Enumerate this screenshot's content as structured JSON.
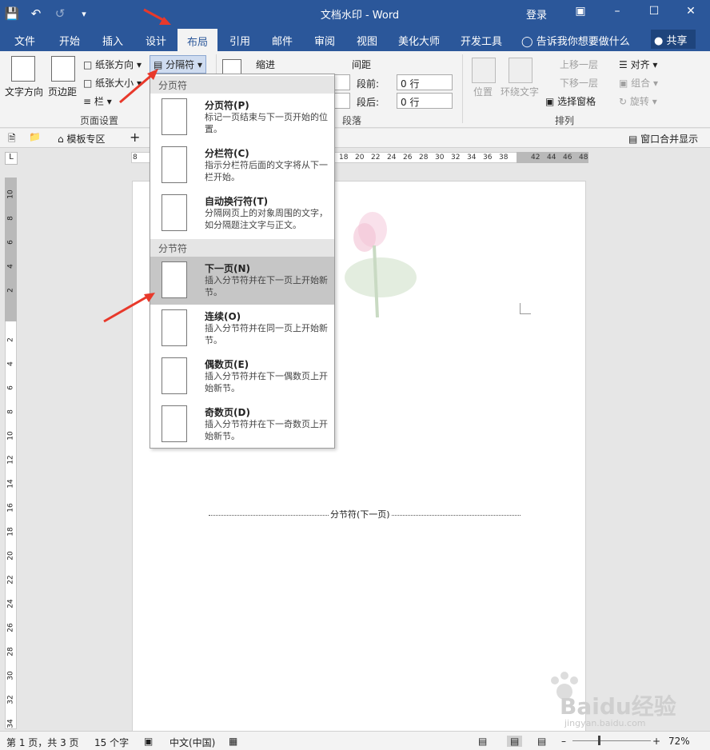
{
  "title": "文档水印 - Word",
  "login": "登录",
  "tabs": [
    "文件",
    "开始",
    "插入",
    "设计",
    "布局",
    "引用",
    "邮件",
    "审阅",
    "视图",
    "美化大师",
    "开发工具"
  ],
  "tell_me": "告诉我你想要做什么",
  "share": "共享",
  "ribbon": {
    "text_direction": "文字方向",
    "margins": "页边距",
    "orientation": "纸张方向",
    "size": "纸张大小",
    "columns": "栏",
    "breaks": "分隔符",
    "group_page_setup": "页面设置",
    "indent_label": "缩进",
    "spacing_label": "间距",
    "before_label": "段前:",
    "before_value": "0 行",
    "after_label": "段后:",
    "after_value": "0 行",
    "group_paragraph": "段落",
    "position": "位置",
    "wrap_text": "环绕文字",
    "bring_forward": "上移一层",
    "send_backward": "下移一层",
    "selection_pane": "选择窗格",
    "align": "对齐",
    "group": "组合",
    "rotate": "旋转",
    "group_arrange": "排列"
  },
  "doc_tabs": {
    "template_zone": "模板专区",
    "plus": "+",
    "window_merge": "窗口合并显示"
  },
  "ruler_top": [
    "8",
    "18",
    "20",
    "22",
    "24",
    "26",
    "28",
    "30",
    "32",
    "34",
    "36",
    "38",
    "42",
    "44",
    "46",
    "48"
  ],
  "ruler_left": [
    "10",
    "8",
    "6",
    "4",
    "2",
    "2",
    "4",
    "6",
    "8",
    "10",
    "12",
    "14",
    "16",
    "18",
    "20",
    "22",
    "24",
    "26",
    "28",
    "30",
    "32",
    "34"
  ],
  "section_break_text": "分节符(下一页)",
  "dropdown": {
    "page_breaks_header": "分页符",
    "section_breaks_header": "分节符",
    "items": [
      {
        "title": "分页符(P)",
        "desc": "标记一页结束与下一页开始的位置。"
      },
      {
        "title": "分栏符(C)",
        "desc": "指示分栏符后面的文字将从下一栏开始。"
      },
      {
        "title": "自动换行符(T)",
        "desc": "分隔网页上的对象周围的文字，如分隔题注文字与正文。"
      },
      {
        "title": "下一页(N)",
        "desc": "插入分节符并在下一页上开始新节。"
      },
      {
        "title": "连续(O)",
        "desc": "插入分节符并在同一页上开始新节。"
      },
      {
        "title": "偶数页(E)",
        "desc": "插入分节符并在下一偶数页上开始新节。"
      },
      {
        "title": "奇数页(D)",
        "desc": "插入分节符并在下一奇数页上开始新节。"
      }
    ]
  },
  "status": {
    "page": "第 1 页，共 3 页",
    "words": "15 个字",
    "lang": "中文(中国)",
    "zoom": "72%"
  },
  "watermark_text": "Baidu经验",
  "watermark_url": "jingyan.baidu.com",
  "colors": {
    "accent": "#2b579a",
    "arrow": "#e8392b"
  }
}
